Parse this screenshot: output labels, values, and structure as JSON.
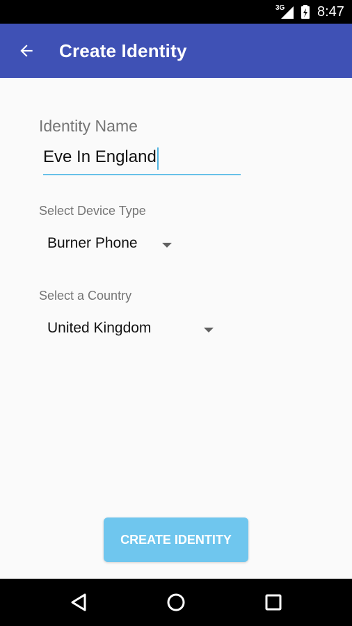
{
  "status_bar": {
    "network": "3G",
    "time": "8:47"
  },
  "app_bar": {
    "title": "Create Identity"
  },
  "form": {
    "identity_name_label": "Identity Name",
    "identity_name_value": "Eve In England",
    "device_type_label": "Select Device Type",
    "device_type_value": "Burner Phone",
    "country_label": "Select a Country",
    "country_value": "United Kingdom"
  },
  "actions": {
    "create_label": "CREATE IDENTITY"
  },
  "colors": {
    "app_bar": "#3f51b5",
    "accent": "#67c1e8",
    "button": "#6fc6ee"
  },
  "icons": [
    "back-arrow-icon",
    "signal-icon",
    "battery-icon",
    "nav-back-icon",
    "nav-home-icon",
    "nav-recents-icon",
    "dropdown-arrow-icon"
  ]
}
